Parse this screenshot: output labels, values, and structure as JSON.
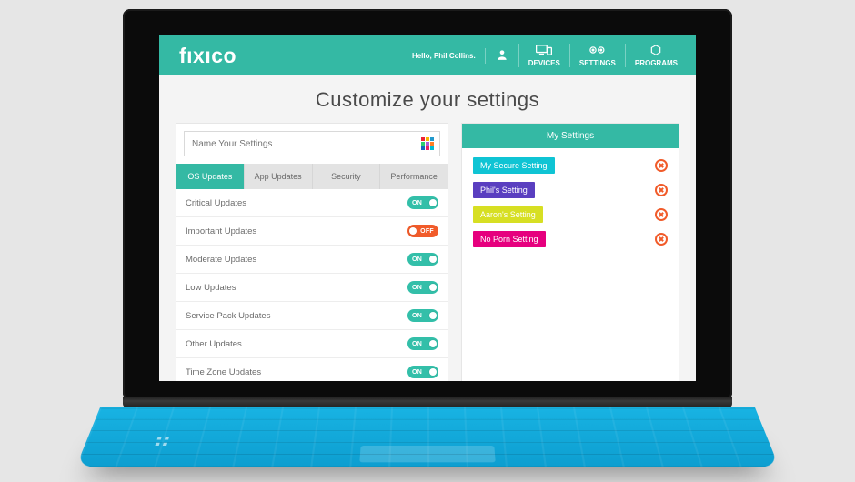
{
  "colors": {
    "accent": "#34b9a4",
    "on": "#33bfa9",
    "off": "#f15b2a"
  },
  "header": {
    "brand": "fıxıco",
    "greeting": "Hello, Phil Collins.",
    "nav": {
      "devices": "DEVICES",
      "settings": "SETTINGS",
      "programs": "PROGRAMS"
    }
  },
  "page_title": "Customize your settings",
  "name_field": {
    "placeholder": "Name Your Settings",
    "value": ""
  },
  "tabs": [
    {
      "label": "OS Updates",
      "active": true
    },
    {
      "label": "App Updates",
      "active": false
    },
    {
      "label": "Security",
      "active": false
    },
    {
      "label": "Performance",
      "active": false
    }
  ],
  "settings": [
    {
      "label": "Critical Updates",
      "state": "ON"
    },
    {
      "label": "Important Updates",
      "state": "OFF"
    },
    {
      "label": "Moderate Updates",
      "state": "ON"
    },
    {
      "label": "Low Updates",
      "state": "ON"
    },
    {
      "label": "Service Pack Updates",
      "state": "ON"
    },
    {
      "label": "Other Updates",
      "state": "ON"
    },
    {
      "label": "Time Zone Updates",
      "state": "ON"
    }
  ],
  "sidebar": {
    "title": "My Settings",
    "items": [
      {
        "label": "My Secure Setting",
        "color": "#0fc4d4"
      },
      {
        "label": "Phil's Setting",
        "color": "#5a3fc0"
      },
      {
        "label": "Aaron's Setting",
        "color": "#d7df23"
      },
      {
        "label": "No Porn Setting",
        "color": "#e6007e"
      }
    ]
  }
}
